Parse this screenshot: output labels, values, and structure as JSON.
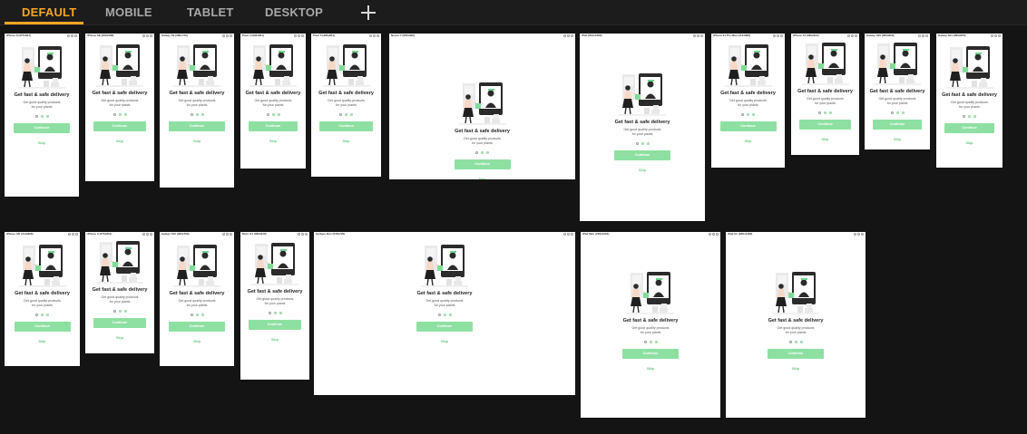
{
  "tabs": [
    {
      "label": "DEFAULT",
      "active": true
    },
    {
      "label": "MOBILE",
      "active": false
    },
    {
      "label": "TABLET",
      "active": false
    },
    {
      "label": "DESKTOP",
      "active": false
    }
  ],
  "add_icon": "plus-icon",
  "accent_color": "#f5a623",
  "button_color": "#8ee0a2",
  "onboarding": {
    "headline": "Get fast & safe delivery",
    "subtext": "Get good quality products for your plants",
    "continue_label": "Continue",
    "skip_label": "Skip"
  },
  "frames": [
    {
      "name": "iPhone 8 (375x667)",
      "active_dot": 0
    },
    {
      "name": "iPhone SE (320x568)",
      "active_dot": 0
    },
    {
      "name": "Galaxy S9 (360x740)",
      "active_dot": 0
    },
    {
      "name": "Pixel 4 (393x851)",
      "active_dot": 0
    },
    {
      "name": "Pixel 5 (393x851)",
      "active_dot": 0
    },
    {
      "name": "Nexus 7 (600x960)",
      "active_dot": 0
    },
    {
      "name": "iPad (810x1080)",
      "active_dot": 0
    },
    {
      "name": "iPhone 11 Pro Max (414x896)",
      "active_dot": 0
    },
    {
      "name": "iPhone 12 (390x844)",
      "active_dot": 0
    },
    {
      "name": "Galaxy S20 (360x800)",
      "active_dot": 0
    },
    {
      "name": "Galaxy S21 (360x800)",
      "active_dot": 0
    },
    {
      "name": "iPhone XR (414x896)",
      "active_dot": 0
    },
    {
      "name": "iPhone X (375x812)",
      "active_dot": 0
    },
    {
      "name": "Galaxy S10 (360x760)",
      "active_dot": 0
    },
    {
      "name": "Moto G4 (360x640)",
      "active_dot": 0
    },
    {
      "name": "Surface Duo (540x720)",
      "active_dot": 0
    },
    {
      "name": "iPad Mini (768x1024)",
      "active_dot": 0
    },
    {
      "name": "iPad Air (820x1180)",
      "active_dot": 0
    }
  ]
}
